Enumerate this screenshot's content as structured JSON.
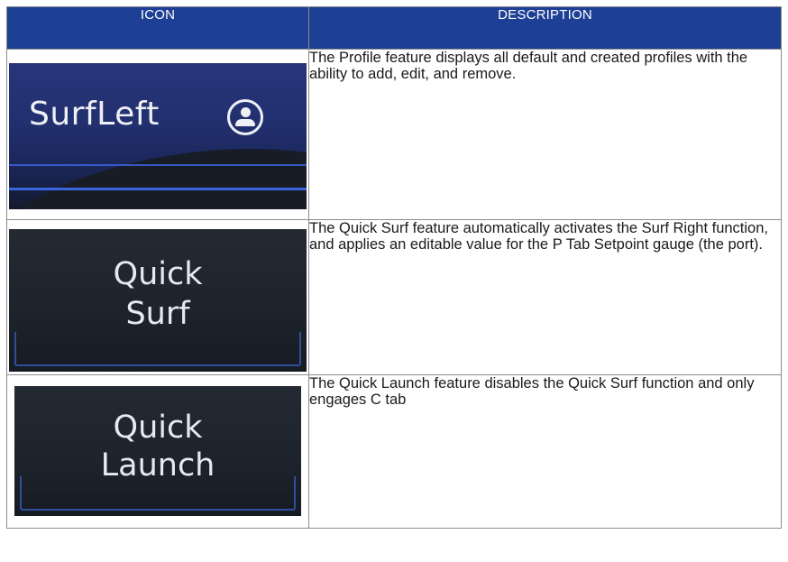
{
  "table": {
    "headers": {
      "icon": "ICON",
      "description": "DESCRIPTION"
    },
    "rows": [
      {
        "icon": {
          "label": "SurfLeft",
          "icon_name": "profile-icon"
        },
        "description": "The Profile feature displays all default and created profiles with the ability to add, edit, and remove."
      },
      {
        "icon": {
          "line1": "Quick",
          "line2": "Surf"
        },
        "description": "The Quick Surf feature automatically activates the Surf Right function, and applies an editable value for the P Tab Setpoint gauge (the port)."
      },
      {
        "icon": {
          "line1": "Quick",
          "line2": "Launch"
        },
        "description": "The Quick Launch feature disables the Quick Surf function and only engages C tab"
      }
    ]
  },
  "colors": {
    "header_bg": "#1d3f95",
    "header_text": "#ffffff",
    "accent_blue": "#3a66e0"
  }
}
